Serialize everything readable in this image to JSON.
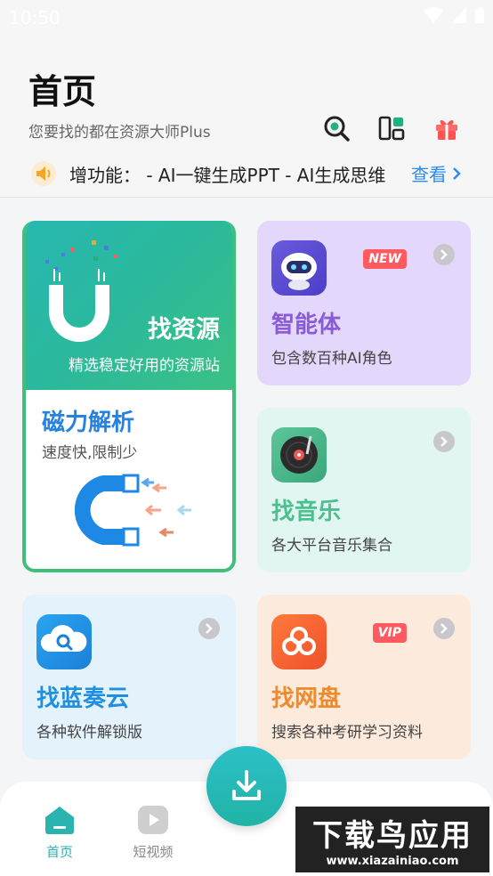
{
  "status": {
    "time": "10:50"
  },
  "header": {
    "title": "首页",
    "subtitle": "您要找的都在资源大师Plus",
    "announcement": "增功能：    - AI一键生成PPT - AI生成思维",
    "view_label": "查看"
  },
  "cards": {
    "find_resource": {
      "title": "找资源",
      "subtitle": "精选稳定好用的资源站"
    },
    "magnet": {
      "title": "磁力解析",
      "subtitle": "速度快,限制少"
    },
    "agent": {
      "title": "智能体",
      "subtitle": "包含数百种AI角色",
      "badge": "NEW"
    },
    "music": {
      "title": "找音乐",
      "subtitle": "各大平台音乐集合"
    },
    "lanzou": {
      "title": "找蓝奏云",
      "subtitle": "各种软件解锁版"
    },
    "netdisk": {
      "title": "找网盘",
      "subtitle": "搜索各种考研学习资料",
      "badge": "VIP"
    }
  },
  "nav": {
    "home": "首页",
    "video": "短视频"
  },
  "watermark": {
    "main": "下载鸟应用",
    "url": "www.xiazainiao.com"
  },
  "colors": {
    "accent": "#2bb99c",
    "link": "#2d8cf0",
    "agent": "#8a5bd6",
    "music": "#4bbf90",
    "lanzou": "#1f8fe0",
    "netdisk": "#f08a2c"
  }
}
